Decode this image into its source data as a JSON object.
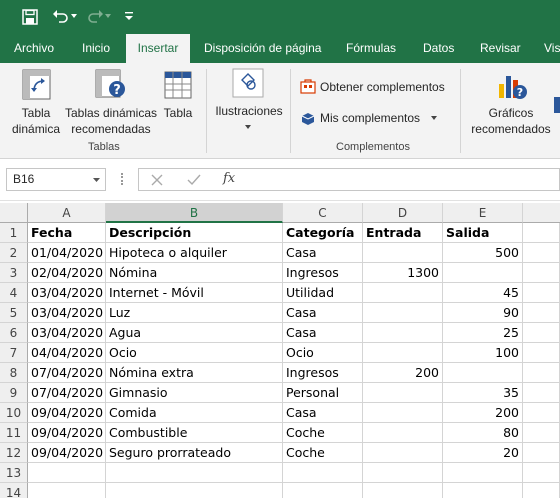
{
  "quick_access": {
    "save_icon": "save-icon",
    "undo_icon": "undo-icon",
    "redo_icon": "redo-icon",
    "customize_icon": "customize-icon"
  },
  "tabs": [
    {
      "label": "Archivo"
    },
    {
      "label": "Inicio"
    },
    {
      "label": "Insertar"
    },
    {
      "label": "Disposición de página"
    },
    {
      "label": "Fórmulas"
    },
    {
      "label": "Datos"
    },
    {
      "label": "Revisar"
    },
    {
      "label": "Vis"
    }
  ],
  "ribbon": {
    "tabla_dinamica": "Tabla\ndinámica",
    "tablas_recomendadas": "Tablas dinámicas\nrecomendadas",
    "tabla": "Tabla",
    "tablas_group": "Tablas",
    "ilustraciones": "Ilustraciones",
    "obtener": "Obtener complementos",
    "mis": "Mis complementos",
    "complementos_group": "Complementos",
    "graficos": "Gráficos\nrecomendados"
  },
  "formula_bar": {
    "name_box": "B16",
    "fx": "fx",
    "value": ""
  },
  "columns": [
    "A",
    "B",
    "C",
    "D",
    "E"
  ],
  "rows": [
    [
      "Fecha",
      "Descripción",
      "Categoría",
      "Entrada",
      "Salida"
    ],
    [
      "01/04/2020",
      "Hipoteca o alquiler",
      "Casa",
      "",
      "500"
    ],
    [
      "02/04/2020",
      "Nómina",
      "Ingresos",
      "1300",
      ""
    ],
    [
      "03/04/2020",
      "Internet - Móvil",
      "Utilidad",
      "",
      "45"
    ],
    [
      "03/04/2020",
      "Luz",
      "Casa",
      "",
      "90"
    ],
    [
      "03/04/2020",
      "Agua",
      "Casa",
      "",
      "25"
    ],
    [
      "04/04/2020",
      "Ocio",
      "Ocio",
      "",
      "100"
    ],
    [
      "07/04/2020",
      "Nómina extra",
      "Ingresos",
      "200",
      ""
    ],
    [
      "07/04/2020",
      "Gimnasio",
      "Personal",
      "",
      "35"
    ],
    [
      "09/04/2020",
      "Comida",
      "Casa",
      "",
      "200"
    ],
    [
      "09/04/2020",
      "Combustible",
      "Coche",
      "",
      "80"
    ],
    [
      "09/04/2020",
      "Seguro prorrateado",
      "Coche",
      "",
      "20"
    ],
    [
      "",
      "",
      "",
      "",
      ""
    ],
    [
      "",
      "",
      "",
      "",
      ""
    ]
  ],
  "row_numbers": [
    "1",
    "2",
    "3",
    "4",
    "5",
    "6",
    "7",
    "8",
    "9",
    "10",
    "11",
    "12",
    "13",
    "14"
  ]
}
